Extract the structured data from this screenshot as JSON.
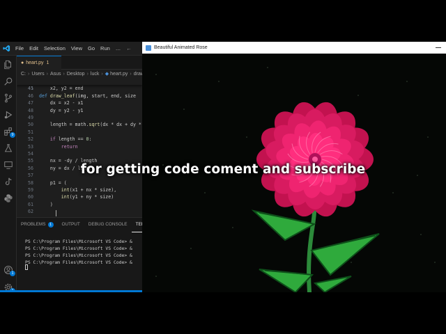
{
  "vscode": {
    "menu": [
      "File",
      "Edit",
      "Selection",
      "View",
      "Go",
      "Run",
      "…"
    ],
    "tab": {
      "name": "heart.py",
      "problems": "1"
    },
    "breadcrumb": [
      "C:",
      "Users",
      "Asus",
      "Desktop",
      "luck",
      "heart.py",
      "draw_leaf"
    ],
    "sticky": {
      "ln": "41",
      "prefix": "def ",
      "name": "draw_leaf",
      "args": "(img, start, end, size"
    },
    "lines": [
      {
        "ln": "45",
        "code": "    x2, y2 = end"
      },
      {
        "ln": "46",
        "code": ""
      },
      {
        "ln": "47",
        "code": "    dx = x2 - x1"
      },
      {
        "ln": "48",
        "code": "    dy = y2 - y1"
      },
      {
        "ln": "49",
        "code": ""
      },
      {
        "ln": "50",
        "code": "    length = math.sqrt(dx * dx + dy * dy)"
      },
      {
        "ln": "51",
        "code": ""
      },
      {
        "ln": "52",
        "code": "    if length == 0:"
      },
      {
        "ln": "53",
        "code": "        return"
      },
      {
        "ln": "54",
        "code": ""
      },
      {
        "ln": "55",
        "code": "    nx = -dy / length"
      },
      {
        "ln": "56",
        "code": "    ny = dx / length"
      },
      {
        "ln": "57",
        "code": ""
      },
      {
        "ln": "58",
        "code": "    p1 = ("
      },
      {
        "ln": "59",
        "code": "        int(x1 + nx * size),"
      },
      {
        "ln": "60",
        "code": "        int(y1 + ny * size)"
      },
      {
        "ln": "61",
        "code": "    )"
      },
      {
        "ln": "62",
        "code": ""
      }
    ],
    "panel_tabs": {
      "problems": "PROBLEMS",
      "problems_count": "1",
      "output": "OUTPUT",
      "debug": "DEBUG CONSOLE",
      "terminal": "TERMI"
    },
    "terminal_lines": [
      "PS C:\\Program Files\\Microsoft VS Code> &",
      "PS C:\\Program Files\\Microsoft VS Code> &",
      "PS C:\\Program Files\\Microsoft VS Code> &",
      "PS C:\\Program Files\\Microsoft VS Code> &"
    ],
    "extensions_badge": "9",
    "accounts_badge": "1",
    "settings_badge": "1",
    "colors": {
      "accent": "#0078d4",
      "editor_bg": "#1e1e1e"
    }
  },
  "rose_window": {
    "title": "Beautiful Animated Rose",
    "colors": {
      "petal_outer": "#c2124f",
      "petal_inner": "#ff2e7e",
      "leaf": "#2faa3c",
      "leaf_edge": "#0e4f1a",
      "stem": "#2c8a3a"
    }
  },
  "caption": "for getting code coment and subscribe"
}
